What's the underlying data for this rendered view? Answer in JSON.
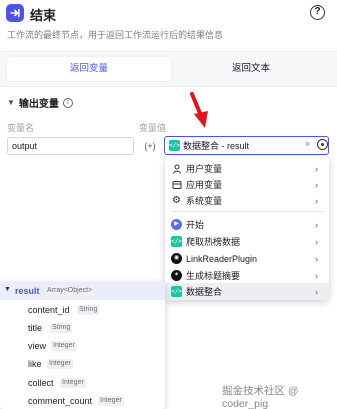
{
  "header": {
    "title": "结束",
    "description": "工作流的最终节点，用于返回工作流运行后的结果信息"
  },
  "tabs": [
    {
      "label": "返回变量",
      "active": true
    },
    {
      "label": "返回文本",
      "active": false
    }
  ],
  "output_section": {
    "title": "输出变量",
    "col_name_label": "变量名",
    "col_value_label": "变量值",
    "row": {
      "name": "output",
      "type_toggle": "(+)",
      "value": "数据整合 - result"
    }
  },
  "dropdown": {
    "items": [
      {
        "label": "用户变量",
        "icon": "user-icon"
      },
      {
        "label": "应用变量",
        "icon": "app-icon"
      },
      {
        "label": "系统变量",
        "icon": "system-gear-icon"
      },
      {
        "label": "开始",
        "icon": "start-node-icon"
      },
      {
        "label": "爬取热榜数据",
        "icon": "code-node-icon"
      },
      {
        "label": "LinkReaderPlugin",
        "icon": "link-reader-icon"
      },
      {
        "label": "生成标题摘要",
        "icon": "llm-node-icon"
      },
      {
        "label": "数据整合",
        "icon": "code-node-icon",
        "highlighted": true
      }
    ]
  },
  "tree": {
    "root": {
      "name": "result",
      "type": "Array<Object>"
    },
    "children": [
      {
        "name": "content_id",
        "type": "String"
      },
      {
        "name": "title",
        "type": "String"
      },
      {
        "name": "view",
        "type": "Integer"
      },
      {
        "name": "like",
        "type": "Integer"
      },
      {
        "name": "collect",
        "type": "Integer"
      },
      {
        "name": "comment_count",
        "type": "Integer"
      }
    ]
  },
  "watermark": "掘金技术社区 @ coder_pig",
  "colors": {
    "accent": "#4d53e8",
    "code_icon": "#1ec3a0",
    "start_icon": "#5a6cf0",
    "arrow": "#e0141b"
  }
}
